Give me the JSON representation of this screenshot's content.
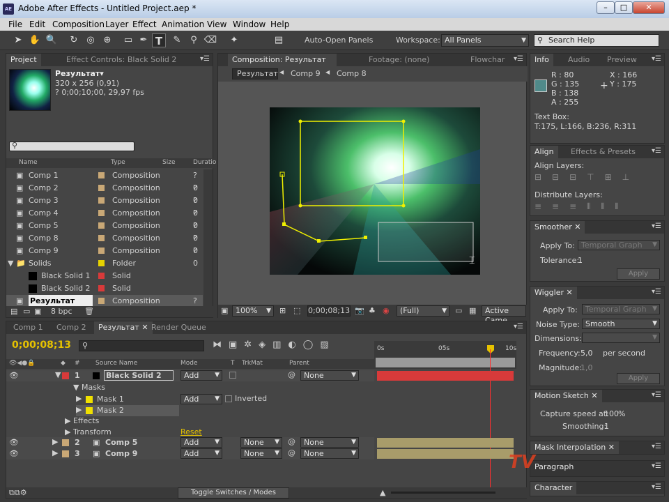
{
  "window": {
    "title": "Adobe After Effects - Untitled Project.aep *",
    "app_icon": "AE"
  },
  "menu": [
    "File",
    "Edit",
    "Composition",
    "Layer",
    "Effect",
    "Animation",
    "View",
    "Window",
    "Help"
  ],
  "toolbar": {
    "auto_open_label": "Auto-Open Panels",
    "workspace_label": "Workspace:",
    "workspace_value": "All Panels",
    "search_placeholder": "Search Help"
  },
  "project": {
    "tabs": [
      "Project",
      "Effect Controls: Black Solid 2"
    ],
    "comp_name": "Результат▾",
    "comp_size": "320 x 256 (0,91)",
    "comp_dur": "? 0;00;10;00, 29,97 fps",
    "cols": [
      "Name",
      "Type",
      "Size",
      "Duratio"
    ],
    "items": [
      {
        "name": "Comp 1",
        "type": "Composition",
        "dur": "? 0",
        "color": "#c9a876",
        "kind": "comp"
      },
      {
        "name": "Comp 2",
        "type": "Composition",
        "dur": "? 0",
        "color": "#c9a876",
        "kind": "comp"
      },
      {
        "name": "Comp 3",
        "type": "Composition",
        "dur": "? 0",
        "color": "#c9a876",
        "kind": "comp"
      },
      {
        "name": "Comp 4",
        "type": "Composition",
        "dur": "? 0",
        "color": "#c9a876",
        "kind": "comp"
      },
      {
        "name": "Comp 5",
        "type": "Composition",
        "dur": "? 0",
        "color": "#c9a876",
        "kind": "comp"
      },
      {
        "name": "Comp 8",
        "type": "Composition",
        "dur": "? 0",
        "color": "#c9a876",
        "kind": "comp"
      },
      {
        "name": "Comp 9",
        "type": "Composition",
        "dur": "? 0",
        "color": "#c9a876",
        "kind": "comp"
      },
      {
        "name": "Solids",
        "type": "Folder",
        "dur": "",
        "color": "#e6d200",
        "kind": "folder"
      },
      {
        "name": "Black Solid 1",
        "type": "Solid",
        "dur": "",
        "color": "#d83a3a",
        "kind": "solid"
      },
      {
        "name": "Black Solid 2",
        "type": "Solid",
        "dur": "",
        "color": "#d83a3a",
        "kind": "solid"
      },
      {
        "name": "Результат",
        "type": "Composition",
        "dur": "? 0",
        "color": "#c9a876",
        "kind": "comp"
      }
    ],
    "bpc": "8 bpc"
  },
  "comp": {
    "tabs": [
      "Composition: Результат",
      "Footage: (none)",
      "Flowchar"
    ],
    "crumbs": [
      "Результат",
      "Comp 9",
      "Comp 8"
    ],
    "zoom": "100%",
    "timecode": "0;00;08;13",
    "res": "(Full)",
    "camera": "Active Came"
  },
  "info": {
    "tabs": [
      "Info",
      "Audio",
      "Preview"
    ],
    "r": "R : 80",
    "g": "G : 135",
    "b": "B : 138",
    "a": "A : 255",
    "x": "X : 166",
    "y": "Y : 175",
    "swatch": "#508a8a",
    "textbox": "Text Box:",
    "bounds": "T:175, L:166, B:236, R:311"
  },
  "align": {
    "tabs": [
      "Align",
      "Effects & Presets"
    ],
    "align_layers": "Align Layers:",
    "distribute_layers": "Distribute Layers:"
  },
  "smoother": {
    "title": "Smoother",
    "apply_to": "Apply To:",
    "apply_value": "Temporal Graph",
    "tolerance": "Tolerance:",
    "tolerance_value": "1",
    "apply_btn": "Apply"
  },
  "wiggler": {
    "title": "Wiggler",
    "apply_to": "Apply To:",
    "apply_value": "Temporal Graph",
    "noise_type": "Noise Type:",
    "noise_value": "Smooth",
    "dimensions": "Dimensions:",
    "frequency": "Frequency:",
    "frequency_value": "5,0",
    "per_second": "per second",
    "magnitude": "Magnitude:",
    "magnitude_value": "1,0",
    "apply_btn": "Apply"
  },
  "motion_sketch": {
    "title": "Motion Sketch",
    "capture": "Capture speed at:",
    "capture_value": "100",
    "percent": "%",
    "smoothing": "Smoothing:",
    "smoothing_value": "1"
  },
  "mask_interp": {
    "title": "Mask Interpolation"
  },
  "paragraph": {
    "title": "Paragraph"
  },
  "character": {
    "title": "Character"
  },
  "timeline": {
    "tabs": [
      "Comp 1",
      "Comp 2",
      "Результат",
      "Render Queue"
    ],
    "timecode": "0;00;08;13",
    "cols": [
      "Source Name",
      "Mode",
      "T",
      "TrkMat",
      "Parent"
    ],
    "ruler": [
      "0s",
      "05s",
      "10s"
    ],
    "layers": [
      {
        "num": "1",
        "name": "Black Solid 2",
        "mode": "Add",
        "trk": "",
        "parent": "None",
        "color": "#d83a3a"
      },
      {
        "num": "2",
        "name": "Comp 5",
        "mode": "Add",
        "trk": "None",
        "parent": "None",
        "color": "#c9a876"
      },
      {
        "num": "3",
        "name": "Comp 9",
        "mode": "Add",
        "trk": "None",
        "parent": "None",
        "color": "#c9a876"
      }
    ],
    "masks_label": "Masks",
    "mask1": "Mask 1",
    "mask1_mode": "Add",
    "inverted": "Inverted",
    "mask2": "Mask 2",
    "effects": "Effects",
    "transform": "Transform",
    "reset": "Reset",
    "toggle": "Toggle Switches / Modes"
  },
  "watermark": "TV"
}
